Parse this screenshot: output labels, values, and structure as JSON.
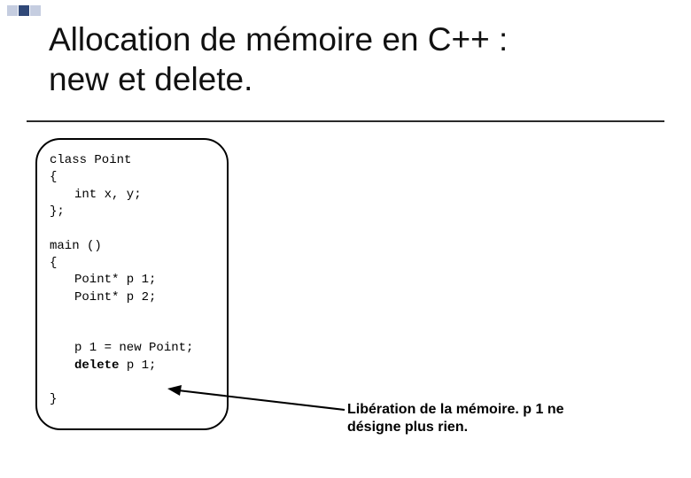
{
  "title_line1": "Allocation de mémoire en C++ :",
  "title_line2": "new et delete.",
  "code": {
    "l1": "class Point",
    "l2": "{",
    "l3": "int x, y;",
    "l4": "};",
    "l5": "main ()",
    "l6": "{",
    "l7": "Point* p 1;",
    "l8": "Point* p 2;",
    "l9": "p 1 = new Point;",
    "l10a": "delete",
    "l10b": " p 1;",
    "l11": "}"
  },
  "caption_line1": "Libération de la mémoire. p 1 ne",
  "caption_line2": "désigne plus rien."
}
